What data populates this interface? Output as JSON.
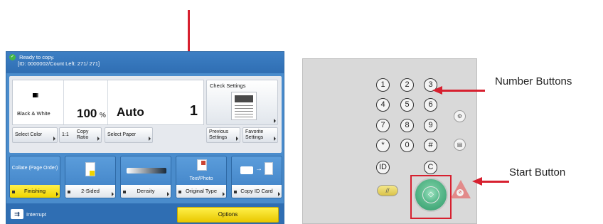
{
  "screen": {
    "status": {
      "line1": "Ready to copy.",
      "line2": "[ID: 0000002/Count Left:  271/  271]"
    },
    "settings": {
      "color": "Black & White",
      "ratio_value": "100",
      "ratio_unit": "%",
      "paper": "Auto",
      "copies": "1"
    },
    "check_settings": "Check Settings",
    "sub_buttons": {
      "select_color": "Select Color",
      "ratio_11": "1:1",
      "copy_ratio": "Copy Ratio",
      "select_paper": "Select Paper",
      "previous_settings": "Previous Settings",
      "favorite_settings": "Favorite Settings"
    },
    "functions": {
      "collate_top": "Collate (Page Order)",
      "finishing": "Finishing",
      "two_sided": "2-Sided",
      "density": "Density",
      "text_photo": "Text/Photo",
      "original_type": "Original Type",
      "copy_id_card": "Copy ID Card"
    },
    "interrupt": "Interrupt",
    "options": "Options"
  },
  "keypad": {
    "digits": [
      "1",
      "2",
      "3",
      "4",
      "5",
      "6",
      "7",
      "8",
      "9",
      "*",
      "0",
      "#"
    ],
    "id_key": "ID",
    "c_key": "C"
  },
  "annotations": {
    "number_buttons": "Number Buttons",
    "start_button": "Start Button"
  },
  "colors": {
    "annotation_red": "#d7202f",
    "screen_blue": "#4a8ccc",
    "highlight_yellow": "#f0d400",
    "start_green": "#2f9a6a"
  }
}
